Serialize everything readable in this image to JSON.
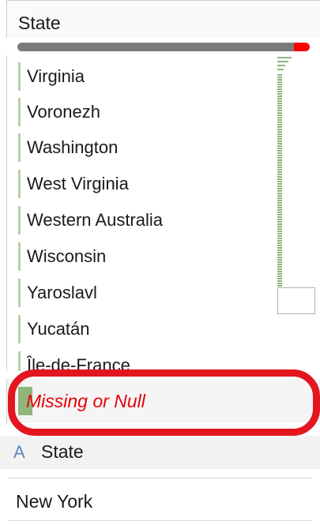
{
  "header": {
    "title": "State"
  },
  "completeness": {
    "missing_fraction": 0.055,
    "bar_color": "#7a7a7a",
    "missing_color": "#ff0000"
  },
  "list": {
    "items": [
      {
        "label": "Virginia"
      },
      {
        "label": "Voronezh"
      },
      {
        "label": "Washington"
      },
      {
        "label": "West Virginia"
      },
      {
        "label": "Western Australia"
      },
      {
        "label": "Wisconsin"
      },
      {
        "label": "Yaroslavl"
      },
      {
        "label": "Yucatán"
      },
      {
        "label": "Île-de-France"
      }
    ],
    "bar_color": "#b6d3a5"
  },
  "null_row": {
    "label": "Missing or Null",
    "label_color": "#e8000b",
    "highlight_color": "#e3161f"
  },
  "field": {
    "type_icon": "A",
    "label": "State"
  },
  "value": {
    "text": "New York"
  }
}
